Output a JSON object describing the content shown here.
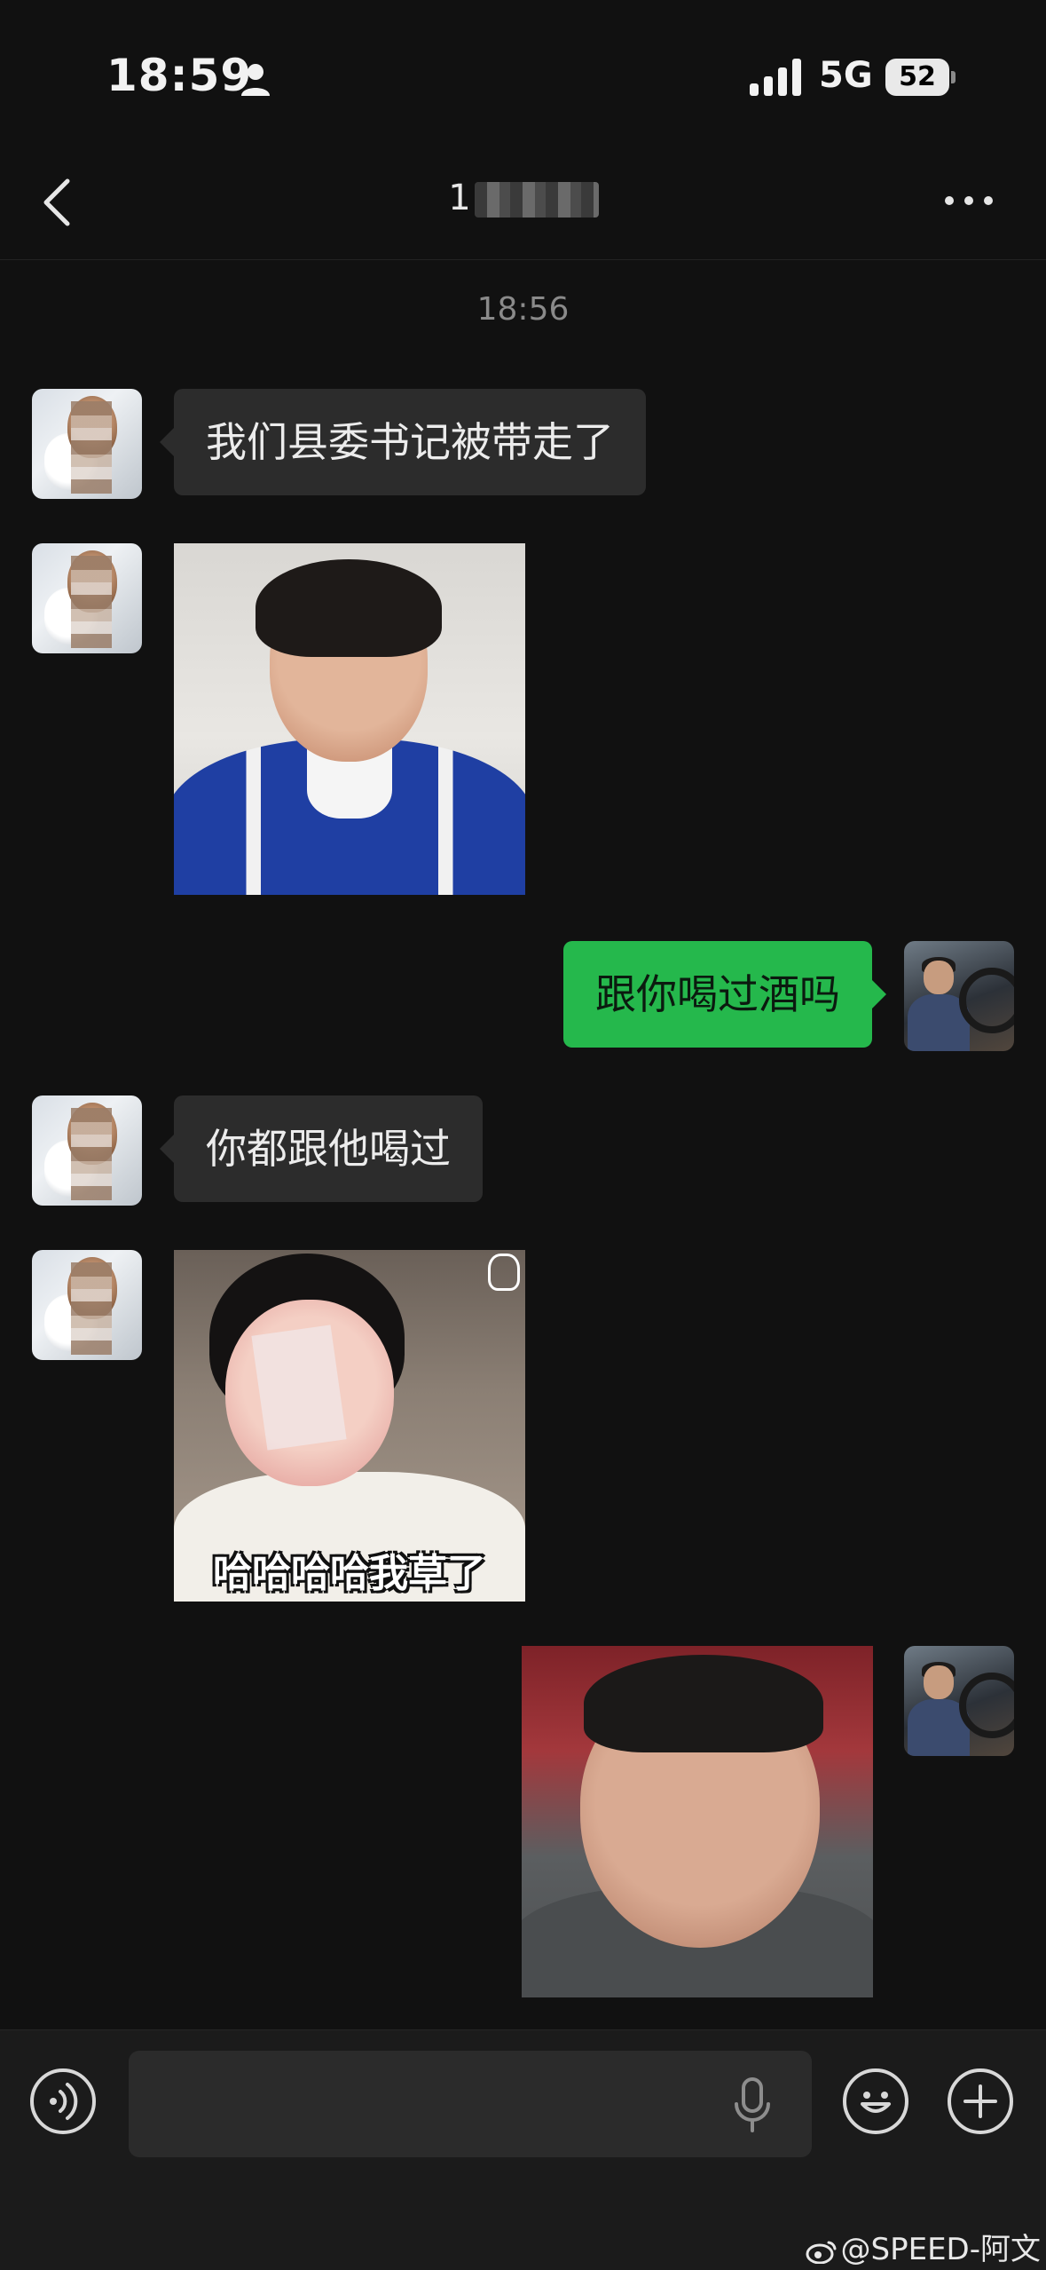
{
  "status_bar": {
    "time": "18:59",
    "network": "5G",
    "battery": "52"
  },
  "header": {
    "title": "1"
  },
  "chat": {
    "timestamp": "18:56",
    "messages": [
      {
        "from": "them",
        "type": "text",
        "text": "我们县委书记被带走了"
      },
      {
        "from": "them",
        "type": "sticker",
        "sticker": "crying-man-sticker"
      },
      {
        "from": "me",
        "type": "text",
        "text": "跟你喝过酒吗"
      },
      {
        "from": "them",
        "type": "text",
        "text": "你都跟他喝过"
      },
      {
        "from": "them",
        "type": "sticker",
        "sticker": "laughing-child-sticker",
        "caption": "哈哈哈哈我草了"
      },
      {
        "from": "me",
        "type": "sticker",
        "sticker": "chubby-boy-sticker"
      }
    ]
  },
  "input_bar": {
    "placeholder": ""
  },
  "watermark": "@SPEED-阿文",
  "colors": {
    "background": "#111111",
    "bubble_in": "#2c2c2c",
    "bubble_out": "#25b84c"
  }
}
